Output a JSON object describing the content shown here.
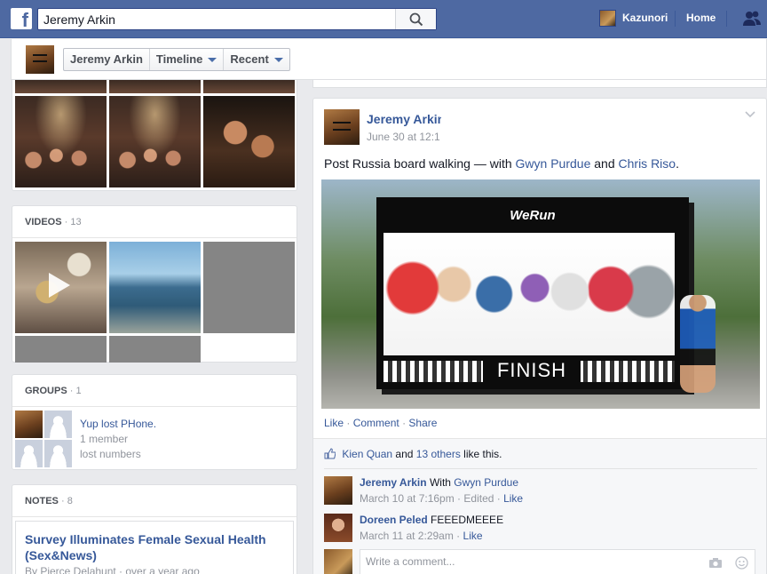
{
  "topbar": {
    "logo": "f",
    "search_value": "Jeremy Arkin",
    "user_name": "Kazunori",
    "home_label": "Home"
  },
  "profile_nav": {
    "name": "Jeremy Arkin",
    "timeline": "Timeline",
    "recent": "Recent"
  },
  "videos": {
    "title": "VIDEOS",
    "count": "· 13"
  },
  "groups": {
    "title": "GROUPS",
    "count": "· 1",
    "item": {
      "name": "Yup lost PHone.",
      "members": "1 member",
      "description": "lost numbers"
    }
  },
  "notes": {
    "title": "NOTES",
    "count": "· 8",
    "item": {
      "title": "Survey Illuminates Female Sexual Health (Sex&News)",
      "byline": "By Pierce Delahunt · over a year ago"
    }
  },
  "post": {
    "author": "Jeremy Arkin",
    "time": "June 30 at 12:1",
    "text_prefix": "Post Russia board walking — with",
    "tag1": "Gwyn Purdue",
    "and": "and",
    "tag2": "Chris Riso",
    "period": ".",
    "image": {
      "brand": "WeRun",
      "finish": "FINISH"
    },
    "actions": {
      "like": "Like",
      "comment": "Comment",
      "share": "Share",
      "sep": "·"
    },
    "likes": {
      "first": "Kien Quan",
      "and": "and",
      "others": "13 others",
      "suffix": "like this."
    },
    "comments": [
      {
        "name": "Jeremy Arkin",
        "text_prefix": "With",
        "text_link": "Gwyn Purdue",
        "meta": "March 10 at 7:16pm · Edited ·",
        "like": "Like"
      },
      {
        "name": "Doreen Peled",
        "text": "FEEEDMEEEE",
        "meta": "March 11 at 2:29am ·",
        "like": "Like"
      }
    ],
    "comment_placeholder": "Write a comment..."
  },
  "colors": {
    "brand_blue": "#4e69a2",
    "link": "#365899",
    "muted": "#90949c"
  }
}
